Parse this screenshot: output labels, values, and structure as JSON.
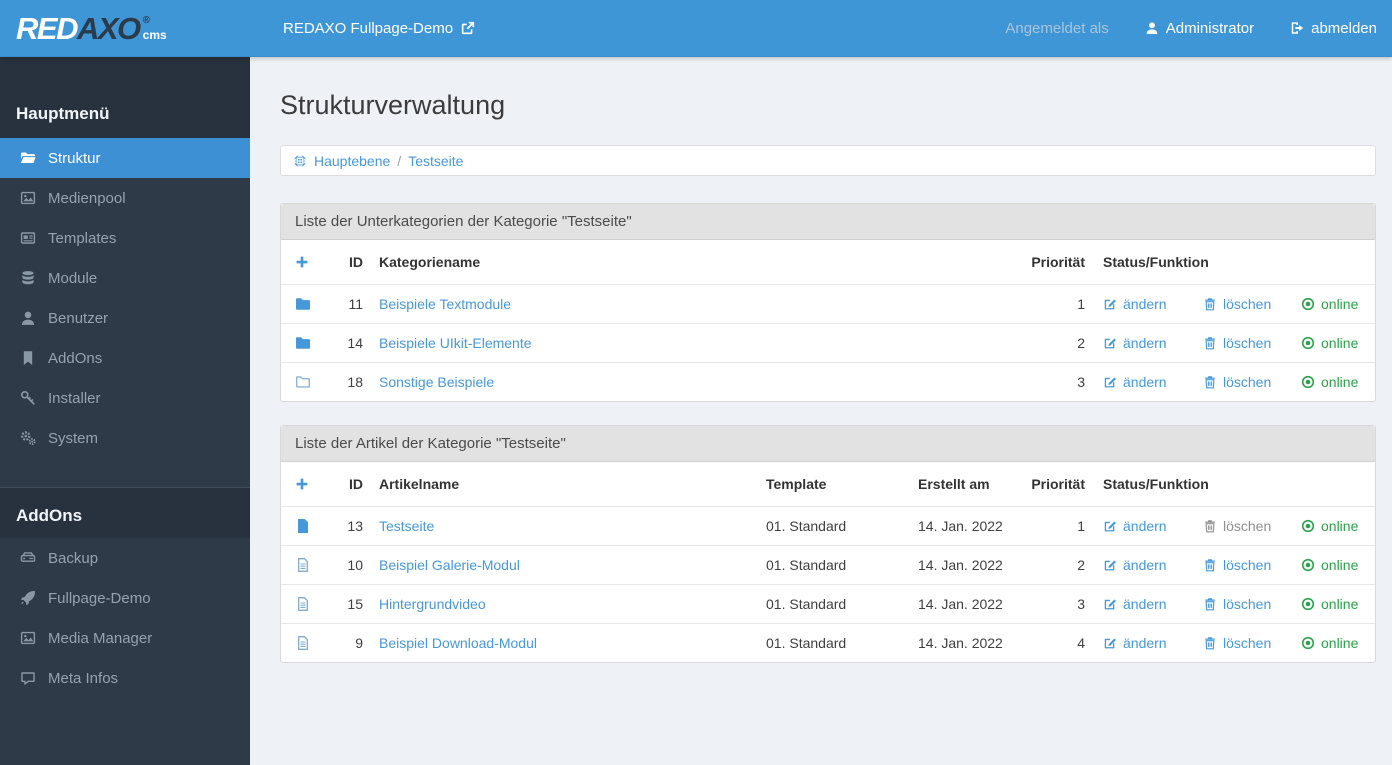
{
  "header": {
    "brand": {
      "red": "RED",
      "axo": "AXO",
      "reg": "®",
      "cms": "cms"
    },
    "site_link": "REDAXO Fullpage-Demo",
    "logged_in_label": "Angemeldet als",
    "user": "Administrator",
    "logout": "abmelden"
  },
  "sidebar": {
    "sections": [
      {
        "title": "Hauptmenü",
        "items": [
          {
            "label": "Struktur",
            "icon": "folder-open-icon",
            "active": true
          },
          {
            "label": "Medienpool",
            "icon": "image-icon",
            "active": false
          },
          {
            "label": "Templates",
            "icon": "newspaper-icon",
            "active": false
          },
          {
            "label": "Module",
            "icon": "database-icon",
            "active": false
          },
          {
            "label": "Benutzer",
            "icon": "user-icon",
            "active": false
          },
          {
            "label": "AddOns",
            "icon": "bookmark-icon",
            "active": false
          },
          {
            "label": "Installer",
            "icon": "key-icon",
            "active": false
          },
          {
            "label": "System",
            "icon": "gears-icon",
            "active": false
          }
        ]
      },
      {
        "title": "AddOns",
        "items": [
          {
            "label": "Backup",
            "icon": "hdd-icon",
            "active": false
          },
          {
            "label": "Fullpage-Demo",
            "icon": "rocket-icon",
            "active": false
          },
          {
            "label": "Media Manager",
            "icon": "image-icon",
            "active": false
          },
          {
            "label": "Meta Infos",
            "icon": "comment-icon",
            "active": false
          }
        ]
      }
    ]
  },
  "main": {
    "title": "Strukturverwaltung",
    "breadcrumb": {
      "root_icon": "globe-icon",
      "root": "Hauptebene",
      "separator": "/",
      "current": "Testseite"
    },
    "actions": {
      "edit": "ändern",
      "delete": "löschen"
    },
    "categories_panel": {
      "title": "Liste der Unterkategorien der Kategorie \"Testseite\"",
      "columns": {
        "add": "+",
        "id": "ID",
        "name": "Kategoriename",
        "priority": "Priorität",
        "status": "Status/Funktion"
      },
      "rows": [
        {
          "icon": "folder-icon",
          "id": "11",
          "name": "Beispiele Textmodule",
          "priority": "1",
          "status": "online"
        },
        {
          "icon": "folder-icon",
          "id": "14",
          "name": "Beispiele UIkit-Elemente",
          "priority": "2",
          "status": "online"
        },
        {
          "icon": "folder-outline-icon",
          "id": "18",
          "name": "Sonstige Beispiele",
          "priority": "3",
          "status": "online"
        }
      ]
    },
    "articles_panel": {
      "title": "Liste der Artikel der Kategorie \"Testseite\"",
      "columns": {
        "add": "+",
        "id": "ID",
        "name": "Artikelname",
        "template": "Template",
        "created": "Erstellt am",
        "priority": "Priorität",
        "status": "Status/Funktion"
      },
      "rows": [
        {
          "icon": "file-filled-icon",
          "id": "13",
          "name": "Testseite",
          "template": "01. Standard",
          "created": "14. Jan. 2022",
          "priority": "1",
          "status": "online"
        },
        {
          "icon": "file-outline-icon",
          "id": "10",
          "name": "Beispiel Galerie-Modul",
          "template": "01. Standard",
          "created": "14. Jan. 2022",
          "priority": "2",
          "status": "online"
        },
        {
          "icon": "file-outline-icon",
          "id": "15",
          "name": "Hintergrundvideo",
          "template": "01. Standard",
          "created": "14. Jan. 2022",
          "priority": "3",
          "status": "online"
        },
        {
          "icon": "file-outline-icon",
          "id": "9",
          "name": "Beispiel Download-Modul",
          "template": "01. Standard",
          "created": "14. Jan. 2022",
          "priority": "4",
          "status": "online"
        }
      ]
    }
  },
  "colors": {
    "header_blue": "#3f96d6",
    "active_item_blue": "#3e90d4",
    "link_blue": "#4798d8",
    "online_green": "#2aa24a",
    "sidebar_dark": "#2e3a47",
    "panel_head_gray": "#e2e2e2"
  }
}
